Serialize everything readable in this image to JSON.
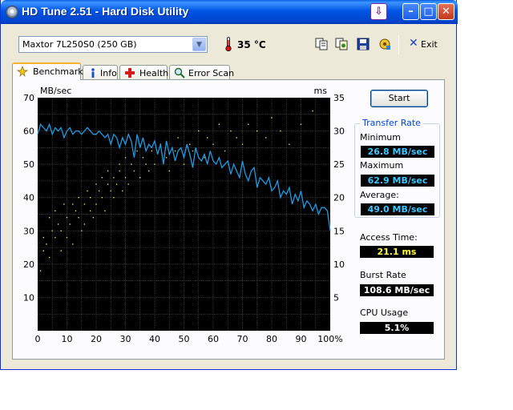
{
  "window": {
    "title": "HD Tune 2.51 - Hard Disk Utility"
  },
  "toolbar": {
    "drive": "Maxtor 7L250S0 (250 GB)",
    "temperature": "35 °C",
    "exit_label": "Exit"
  },
  "tabs": [
    {
      "label": "Benchmark",
      "active": true
    },
    {
      "label": "Info",
      "active": false
    },
    {
      "label": "Health",
      "active": false
    },
    {
      "label": "Error Scan",
      "active": false
    }
  ],
  "benchmark": {
    "start_label": "Start",
    "transfer_rate_title": "Transfer Rate",
    "minimum_label": "Minimum",
    "minimum_value": "26.8 MB/sec",
    "maximum_label": "Maximum",
    "maximum_value": "62.9 MB/sec",
    "average_label": "Average:",
    "average_value": "49.0 MB/sec",
    "access_time_label": "Access Time:",
    "access_time_value": "21.1 ms",
    "burst_rate_label": "Burst Rate",
    "burst_rate_value": "108.6 MB/sec",
    "cpu_usage_label": "CPU Usage",
    "cpu_usage_value": "5.1%"
  },
  "colors": {
    "transfer_line": "#1e9ce6",
    "access_dots": "#e6e64a",
    "grid": "#4a4a4a",
    "plot_bg": "#000000",
    "legend_title": "#0046d5"
  },
  "chart_data": {
    "type": "line",
    "left_axis_unit": "MB/sec",
    "right_axis_unit": "ms",
    "left_ticks": [
      10,
      20,
      30,
      40,
      50,
      60,
      70
    ],
    "right_ticks": [
      5,
      10,
      15,
      20,
      25,
      30,
      35
    ],
    "x_ticks": [
      "0",
      "10",
      "20",
      "30",
      "40",
      "50",
      "60",
      "70",
      "80",
      "90",
      "100%"
    ],
    "xlim": [
      0,
      100
    ],
    "ylim_left": [
      0,
      70
    ],
    "ylim_right": [
      0,
      35
    ],
    "grid": true,
    "series": [
      {
        "axis": "left",
        "x": [
          0,
          1,
          2,
          3,
          4,
          5,
          6,
          7,
          8,
          9,
          10,
          11,
          12,
          13,
          14,
          15,
          16,
          17,
          18,
          19,
          20,
          21,
          22,
          23,
          24,
          25,
          26,
          27,
          28,
          29,
          30,
          31,
          32,
          33,
          34,
          35,
          36,
          37,
          38,
          39,
          40,
          41,
          42,
          43,
          44,
          45,
          46,
          47,
          48,
          49,
          50,
          51,
          52,
          53,
          54,
          55,
          56,
          57,
          58,
          59,
          60,
          61,
          62,
          63,
          64,
          65,
          66,
          67,
          68,
          69,
          70,
          71,
          72,
          73,
          74,
          75,
          76,
          77,
          78,
          79,
          80,
          81,
          82,
          83,
          84,
          85,
          86,
          87,
          88,
          89,
          90,
          91,
          92,
          93,
          94,
          95,
          96,
          97,
          98,
          99,
          100
        ],
        "values": [
          59,
          62,
          61,
          60,
          62,
          59,
          61,
          60,
          61,
          58,
          60,
          61,
          59,
          60,
          60,
          59,
          60,
          61,
          60,
          59,
          59,
          60,
          59,
          58,
          59,
          56,
          59,
          58,
          55,
          58,
          56,
          59,
          57,
          52,
          59,
          55,
          58,
          54,
          56,
          55,
          57,
          53,
          56,
          50,
          57,
          53,
          55,
          51,
          54,
          55,
          52,
          56,
          53,
          49,
          55,
          52,
          51,
          53,
          50,
          54,
          51,
          50,
          52,
          49,
          50,
          51,
          47,
          50,
          48,
          46,
          51,
          47,
          45,
          48,
          49,
          43,
          46,
          45,
          44,
          46,
          42,
          43,
          45,
          40,
          42,
          41,
          43,
          38,
          41,
          39,
          42,
          37,
          39,
          38,
          36,
          38,
          35,
          37,
          37,
          36,
          30
        ]
      },
      {
        "axis": "right",
        "type": "scatter",
        "x": [
          1,
          2,
          2,
          3,
          4,
          4,
          5,
          6,
          6,
          7,
          8,
          8,
          9,
          10,
          10,
          11,
          12,
          12,
          13,
          14,
          14,
          15,
          16,
          16,
          17,
          18,
          18,
          19,
          20,
          20,
          21,
          22,
          22,
          23,
          24,
          24,
          25,
          26,
          26,
          27,
          28,
          28,
          29,
          30,
          30,
          31,
          32,
          33,
          34,
          35,
          36,
          37,
          38,
          39,
          40,
          42,
          44,
          45,
          47,
          48,
          50,
          52,
          53,
          55,
          57,
          58,
          60,
          62,
          64,
          66,
          68,
          70,
          72,
          75,
          78,
          80,
          83,
          86,
          90,
          94
        ],
        "values": [
          9,
          14,
          12,
          13,
          17,
          11,
          15,
          14,
          18,
          16,
          12,
          15,
          19,
          17,
          14,
          16,
          19,
          13,
          18,
          17,
          20,
          15,
          19,
          16,
          21,
          18,
          20,
          17,
          19,
          22,
          21,
          20,
          23,
          18,
          22,
          24,
          21,
          20,
          23,
          22,
          25,
          24,
          21,
          23,
          26,
          22,
          25,
          24,
          27,
          23,
          26,
          25,
          24,
          27,
          25,
          28,
          26,
          24,
          27,
          29,
          25,
          28,
          27,
          30,
          26,
          29,
          28,
          31,
          27,
          30,
          29,
          28,
          31,
          30,
          29,
          32,
          30,
          28,
          31,
          33
        ]
      }
    ]
  }
}
